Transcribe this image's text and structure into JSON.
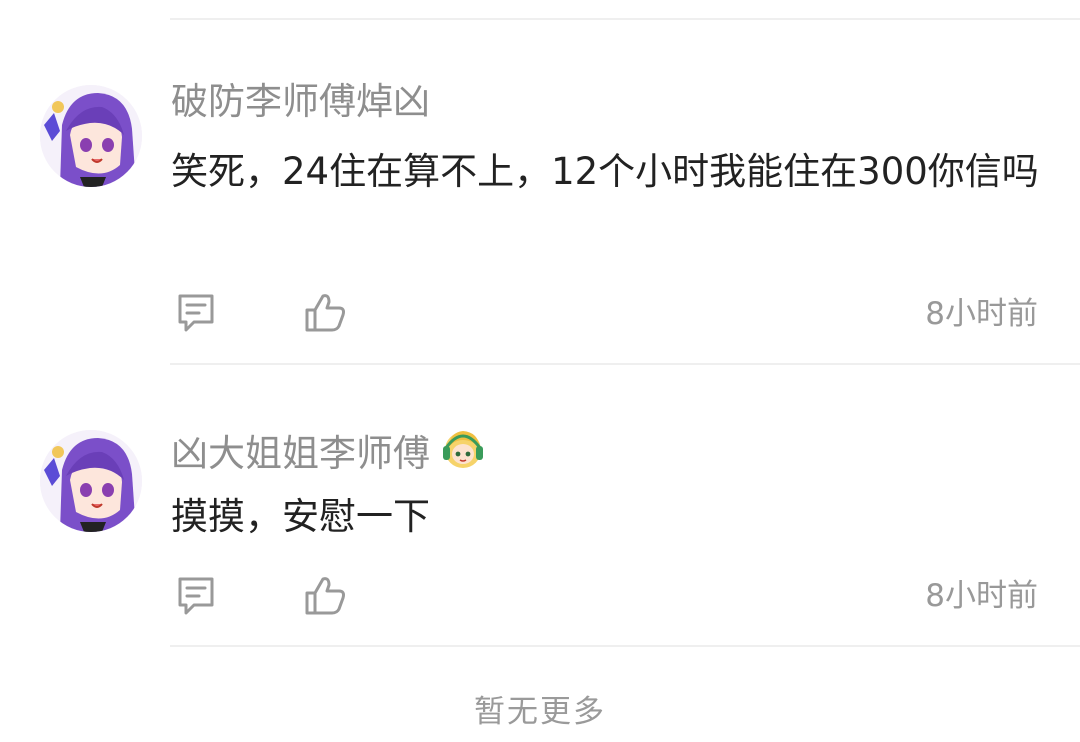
{
  "comments": [
    {
      "username": "破防李师傅焯凶",
      "content": "笑死，24住在算不上，12个小时我能住在300你信吗",
      "avatar_icon": "anime-girl-purple-hair-avatar",
      "reply_icon": "comment-icon",
      "like_icon": "thumbs-up-icon",
      "time": "8小时前"
    },
    {
      "username": "凶大姐姐李师傅",
      "badge_icon": "blonde-girl-headphones-badge",
      "content": "摸摸，安慰一下",
      "avatar_icon": "anime-girl-purple-hair-avatar",
      "reply_icon": "comment-icon",
      "like_icon": "thumbs-up-icon",
      "time": "8小时前"
    }
  ],
  "footer": {
    "no_more_text": "暂无更多"
  },
  "colors": {
    "username": "#8e8e8e",
    "content": "#222222",
    "meta": "#999999",
    "divider": "#efefef",
    "avatar_hair": "#7b4fc9"
  }
}
